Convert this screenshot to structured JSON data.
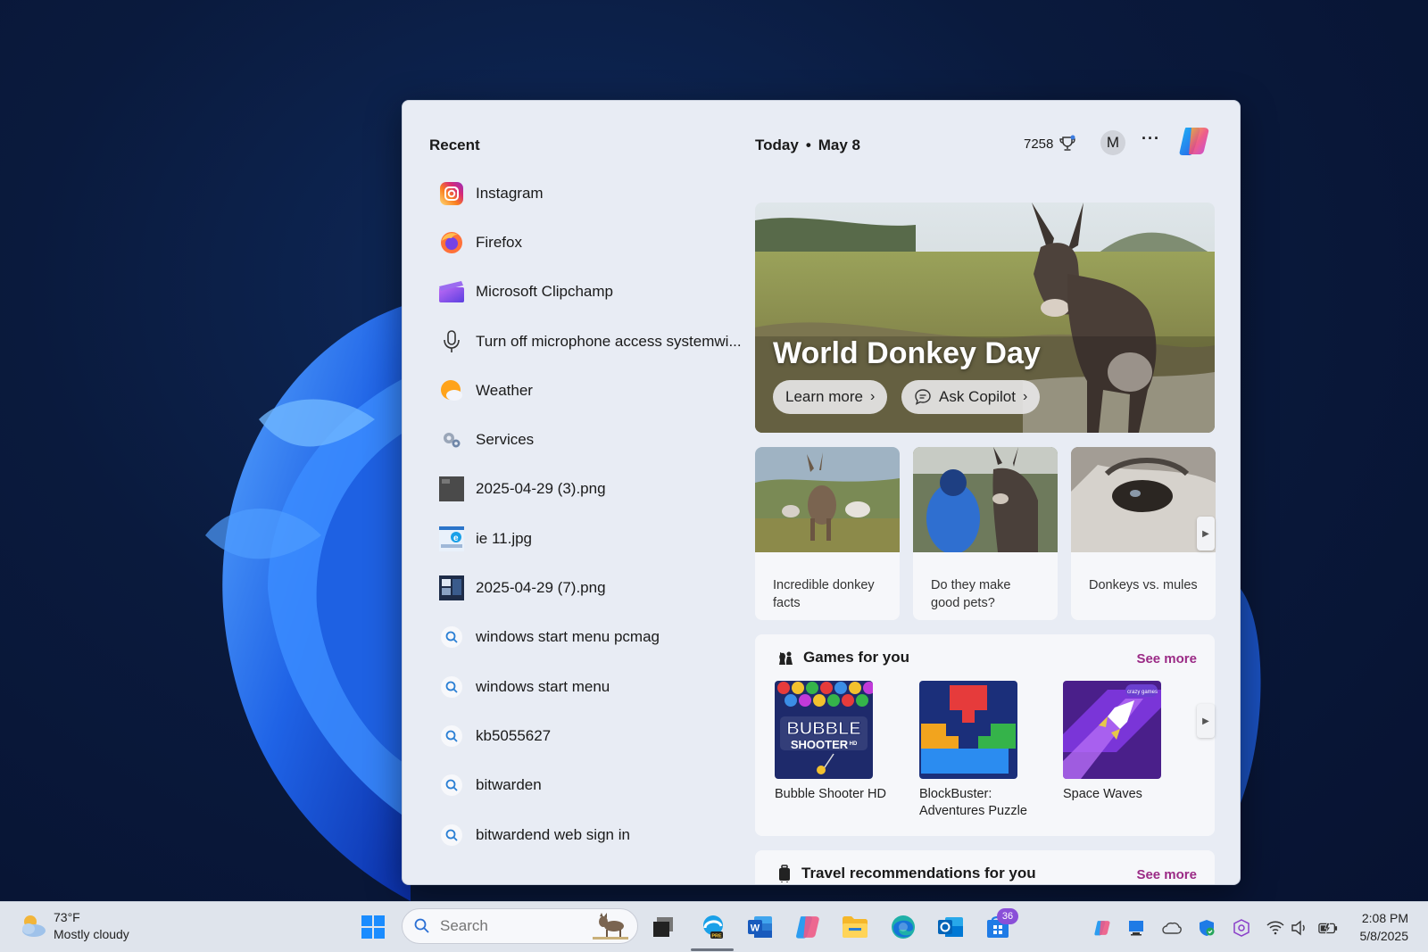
{
  "recent": {
    "title": "Recent",
    "items": [
      {
        "label": "Instagram",
        "icon": "instagram-icon"
      },
      {
        "label": "Firefox",
        "icon": "firefox-icon"
      },
      {
        "label": "Microsoft Clipchamp",
        "icon": "clipchamp-icon"
      },
      {
        "label": "Turn off microphone access systemwi...",
        "icon": "microphone-icon"
      },
      {
        "label": "Weather",
        "icon": "weather-icon"
      },
      {
        "label": "Services",
        "icon": "services-icon"
      },
      {
        "label": "2025-04-29 (3).png",
        "icon": "image-file-icon"
      },
      {
        "label": "ie 11.jpg",
        "icon": "image-file-icon"
      },
      {
        "label": "2025-04-29 (7).png",
        "icon": "image-file-icon"
      },
      {
        "label": "windows start menu pcmag",
        "icon": "search-icon"
      },
      {
        "label": "windows start menu",
        "icon": "search-icon"
      },
      {
        "label": "kb5055627",
        "icon": "search-icon"
      },
      {
        "label": "bitwarden",
        "icon": "search-icon"
      },
      {
        "label": "bitwardend web sign in",
        "icon": "search-icon"
      }
    ]
  },
  "header": {
    "today": "Today",
    "separator": "•",
    "date": "May 8",
    "points": "7258",
    "avatar": "M",
    "more": "···"
  },
  "hero": {
    "title": "World Donkey Day",
    "learn_more": "Learn more",
    "ask_copilot": "Ask Copilot"
  },
  "cards": [
    {
      "caption": "Incredible donkey facts"
    },
    {
      "caption": "Do they make good pets?"
    },
    {
      "caption": "Donkeys vs. mules"
    }
  ],
  "games": {
    "title": "Games for you",
    "see_more": "See more",
    "items": [
      {
        "name": "Bubble Shooter HD",
        "tile_text_1": "BUBBLE",
        "tile_text_2": "SHOOTER",
        "tile_text_3": "HD"
      },
      {
        "name": "BlockBuster: Adventures Puzzle"
      },
      {
        "name": "Space Waves",
        "tile_badge": "crazy games"
      }
    ]
  },
  "travel": {
    "title": "Travel recommendations for you",
    "see_more": "See more"
  },
  "taskbar": {
    "weather_temp": "73°F",
    "weather_desc": "Mostly cloudy",
    "search_placeholder": "Search",
    "notification_count": "36",
    "time": "2:08 PM",
    "date": "5/8/2025"
  },
  "colors": {
    "accent_pink": "#9b2b86",
    "panel_bg": "#e8ecf4",
    "taskbar_bg": "#dfe4ec"
  }
}
